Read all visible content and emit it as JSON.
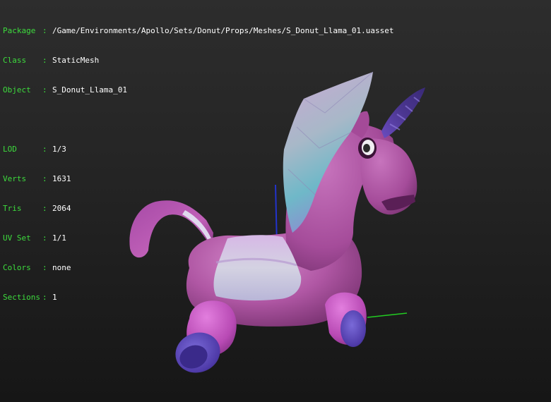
{
  "info": {
    "package": {
      "key": "Package",
      "value": "/Game/Environments/Apollo/Sets/Donut/Props/Meshes/S_Donut_Llama_01.uasset"
    },
    "class": {
      "key": "Class",
      "value": "StaticMesh"
    },
    "object": {
      "key": "Object",
      "value": "S_Donut_Llama_01"
    },
    "lod": {
      "key": "LOD",
      "value": "1/3"
    },
    "verts": {
      "key": "Verts",
      "value": "1631"
    },
    "tris": {
      "key": "Tris",
      "value": "2064"
    },
    "uvset": {
      "key": "UV Set",
      "value": "1/1"
    },
    "colors": {
      "key": "Colors",
      "value": "none"
    },
    "sections": {
      "key": "Sections",
      "value": "1"
    }
  },
  "colors": {
    "label": "#3ddc3d",
    "value": "#ffffff",
    "mesh_body": "#b45aa8",
    "mesh_saddle": "#c9c6dc",
    "mesh_horn": "#5a3fa0",
    "axis_x": "#22cc22",
    "axis_z": "#2233cc"
  },
  "sep": ":"
}
